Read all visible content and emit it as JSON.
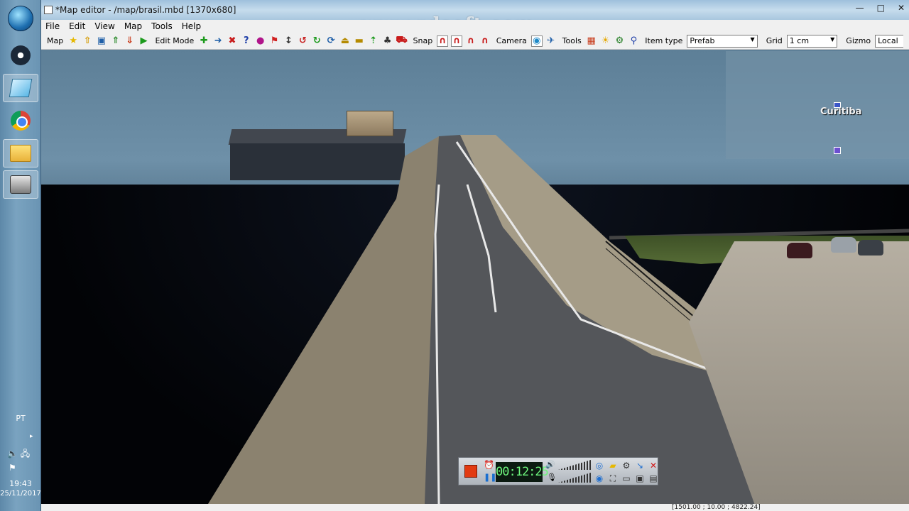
{
  "taskbar": {
    "language": "PT",
    "clock_time": "19:43",
    "clock_date": "25/11/2017"
  },
  "window": {
    "title": "*Map editor - /map/brasil.mbd [1370x680]",
    "watermark": "www.zdsoft.com",
    "minimize": "—",
    "maximize": "□",
    "close": "✕"
  },
  "menu": {
    "items": [
      "File",
      "Edit",
      "View",
      "Map",
      "Tools",
      "Help"
    ]
  },
  "toolbar": {
    "map_label": "Map",
    "edit_mode_label": "Edit Mode",
    "snap_label": "Snap",
    "camera_label": "Camera",
    "tools_label": "Tools",
    "item_type_label": "Item type",
    "item_type_value": "Prefab",
    "grid_label": "Grid",
    "grid_value": "1 cm",
    "gizmo_label": "Gizmo",
    "local_label": "Local"
  },
  "minimap": {
    "city_label": "Curitiba"
  },
  "recorder": {
    "timer": "00:12:25"
  },
  "statusbar": {
    "coords": "[1501.00 ; 10.00 ; 4822.24]"
  },
  "colors": {
    "rec_stop": "#e23b12",
    "timer_text": "#6ef57d",
    "sky": "#6e90a8"
  }
}
